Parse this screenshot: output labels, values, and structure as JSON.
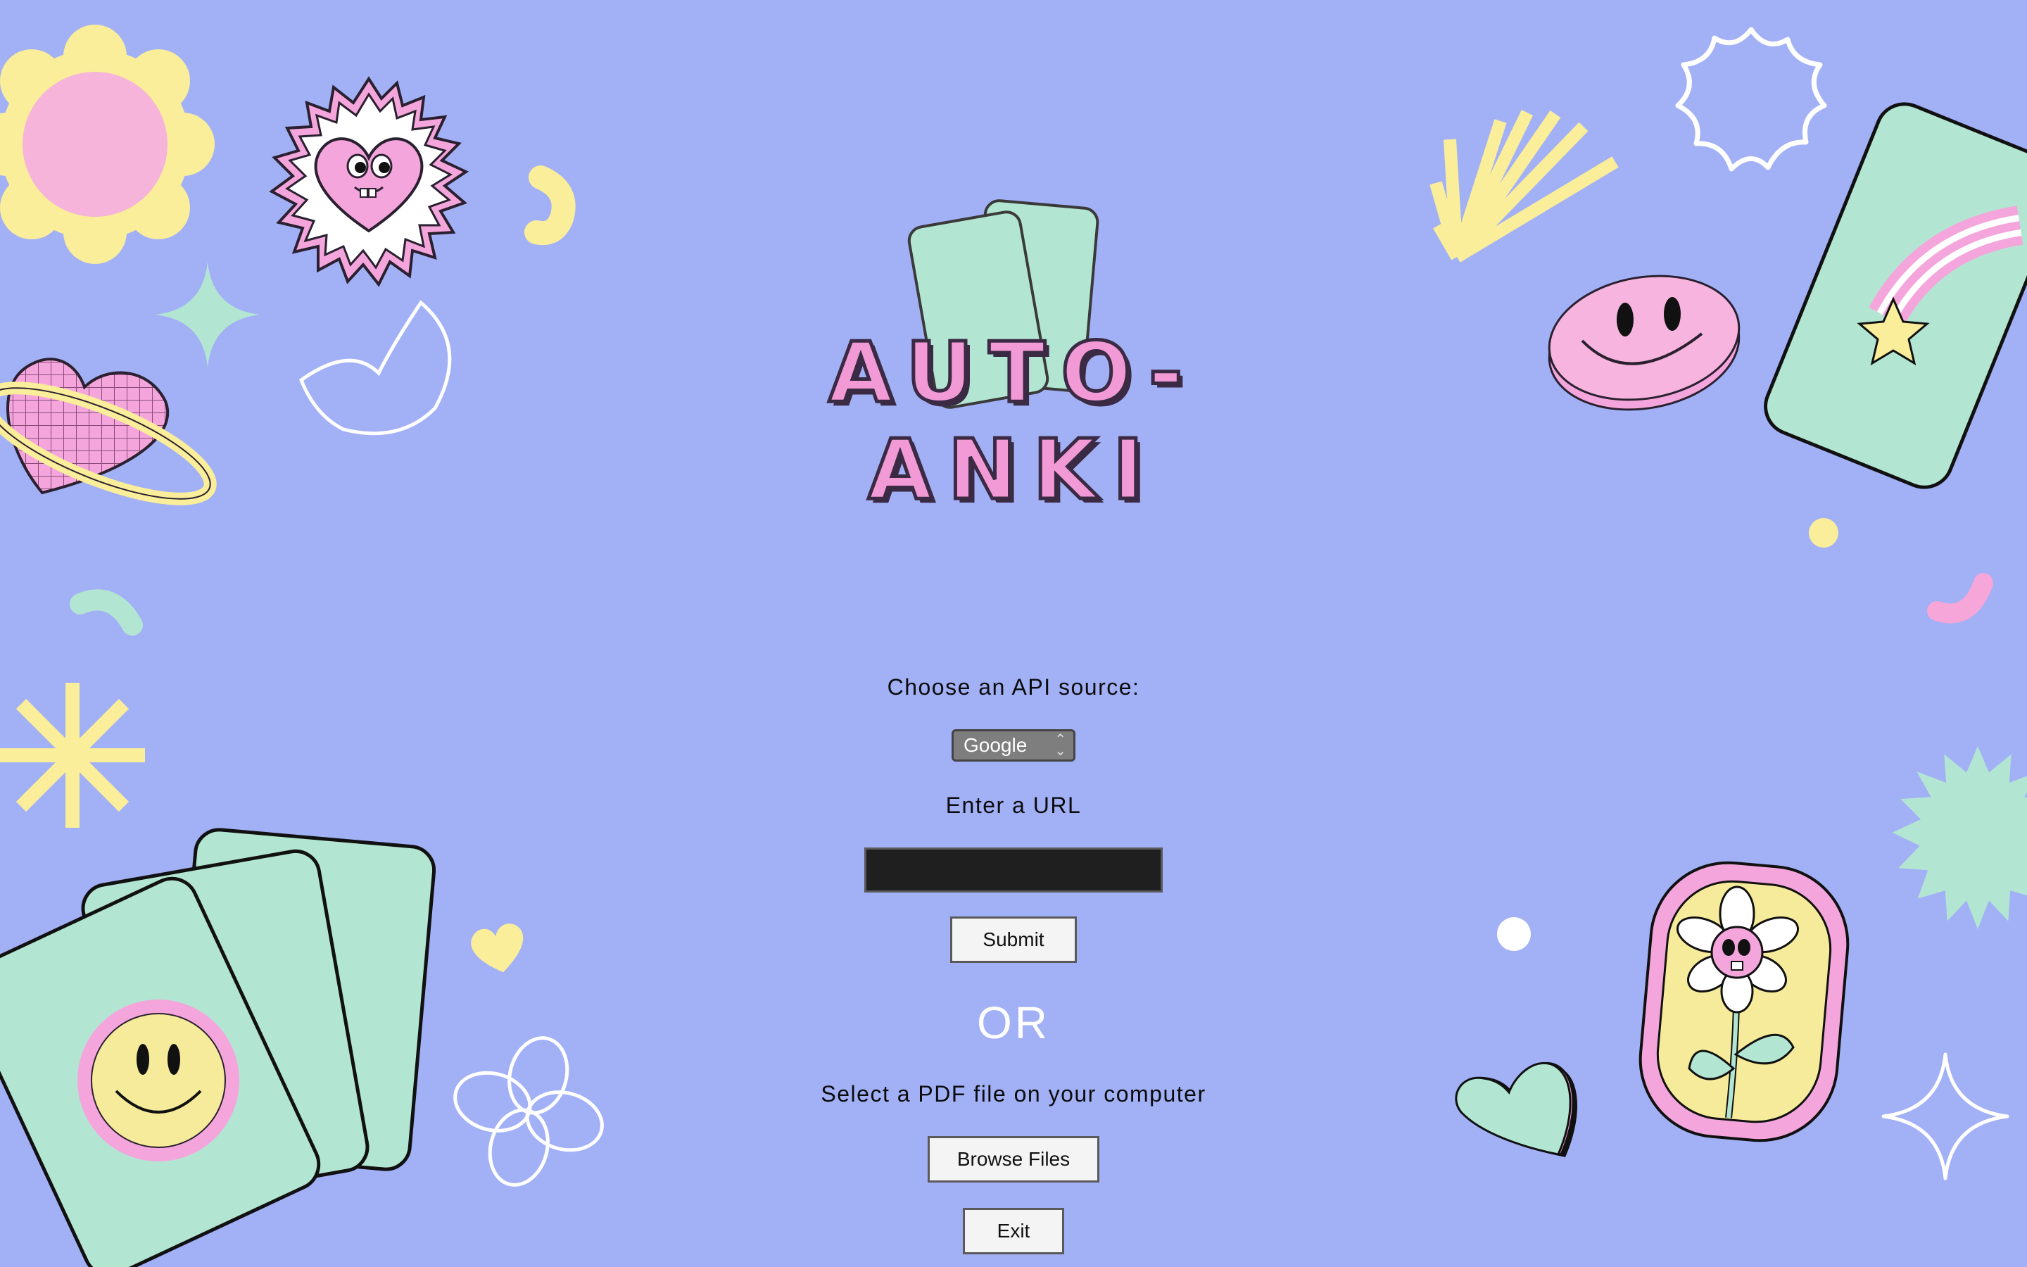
{
  "app": {
    "logo_text": "AUTO-ANKI"
  },
  "api": {
    "label": "Choose an API source:",
    "selected": "Google"
  },
  "url": {
    "label": "Enter a URL",
    "value": ""
  },
  "submit_label": "Submit",
  "or_label": "OR",
  "pdf": {
    "label": "Select a PDF file on your computer",
    "browse_label": "Browse Files"
  },
  "exit_label": "Exit",
  "colors": {
    "background": "#a2b0f6",
    "pink": "#f4a6dc",
    "mint": "#b3e6d2",
    "yellow": "#faee9a",
    "white": "#ffffff",
    "outline": "#2a2030"
  }
}
